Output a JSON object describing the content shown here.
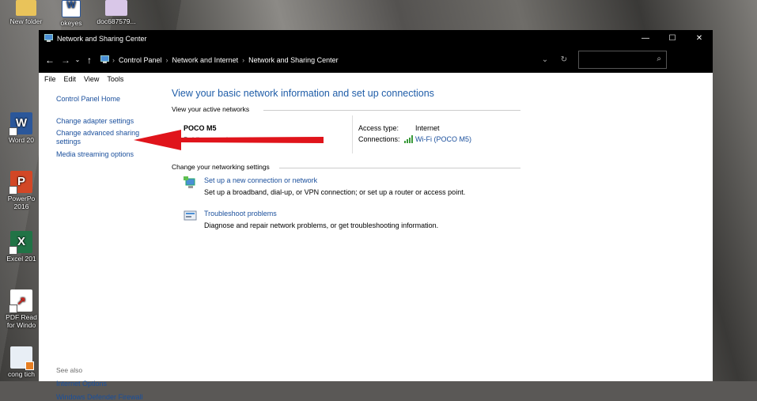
{
  "desktop": {
    "icons": [
      {
        "label": "New folder"
      },
      {
        "label": "okeyes"
      },
      {
        "label": "doc687579..."
      },
      {
        "label": "Word 20"
      },
      {
        "label": "PowerPo\n2016"
      },
      {
        "label": "Excel 201"
      },
      {
        "label": "PDF Read\nfor Windo"
      },
      {
        "label": "cong tich"
      }
    ]
  },
  "window": {
    "title": "Network and Sharing Center",
    "controls": {
      "minimize": "—",
      "maximize": "☐",
      "close": "✕"
    }
  },
  "address": {
    "breadcrumbs": [
      "Control Panel",
      "Network and Internet",
      "Network and Sharing Center"
    ]
  },
  "menu": [
    "File",
    "Edit",
    "View",
    "Tools"
  ],
  "sidebar": {
    "home": "Control Panel Home",
    "items": [
      "Change adapter settings",
      "Change advanced sharing settings",
      "Media streaming options"
    ],
    "see_also_title": "See also",
    "see_also": [
      "Internet Options",
      "Windows Defender Firewall"
    ]
  },
  "main": {
    "heading": "View your basic network information and set up connections",
    "active_title": "View your active networks",
    "network_name": "POCO M5",
    "network_type": "Public network",
    "access_type_label": "Access type:",
    "access_type_value": "Internet",
    "connections_label": "Connections:",
    "connections_value": "Wi-Fi (POCO M5)",
    "change_title": "Change your networking settings",
    "tasks": [
      {
        "link": "Set up a new connection or network",
        "desc": "Set up a broadband, dial-up, or VPN connection; or set up a router or access point."
      },
      {
        "link": "Troubleshoot problems",
        "desc": "Diagnose and repair network problems, or get troubleshooting information."
      }
    ]
  },
  "annotation": {
    "color": "#e0141b"
  }
}
